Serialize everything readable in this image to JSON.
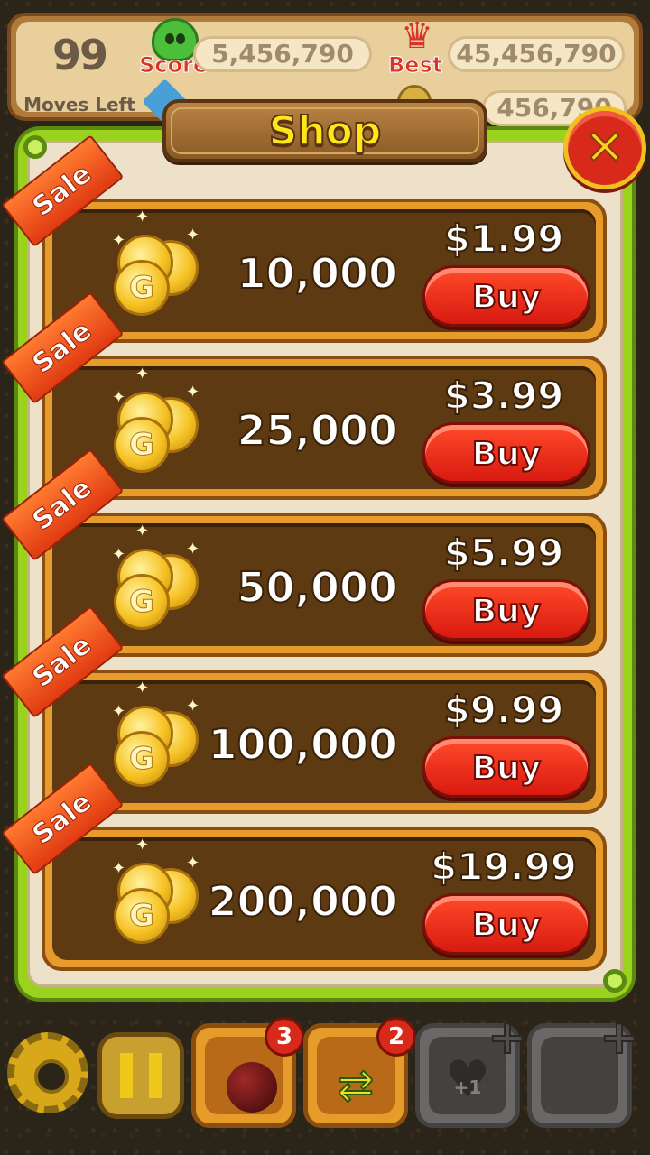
{
  "hud": {
    "moves_value": "99",
    "moves_label": "Moves Left",
    "score_label": "Score",
    "score_value": "5,456,790",
    "best_label": "Best",
    "best_value": "45,456,790",
    "second_value": "456,790"
  },
  "shop": {
    "title": "Shop",
    "close_symbol": "✕",
    "sale_label": "Sale",
    "coin_symbol": "G",
    "buy_label": "Buy",
    "items": [
      {
        "amount": "10,000",
        "price": "$1.99"
      },
      {
        "amount": "25,000",
        "price": "$3.99"
      },
      {
        "amount": "50,000",
        "price": "$5.99"
      },
      {
        "amount": "100,000",
        "price": "$9.99"
      },
      {
        "amount": "200,000",
        "price": "$19.99"
      }
    ]
  },
  "toolbar": {
    "bomb_count": "3",
    "shuffle_count": "2",
    "heart_label": "+1",
    "plus_symbol": "+"
  },
  "colors": {
    "panel_border": "#9ad21e",
    "title_text": "#ffe61a",
    "buy_button": "#d81a10",
    "sale_ribbon": "#e03a12",
    "row_frame": "#e79b2a"
  }
}
